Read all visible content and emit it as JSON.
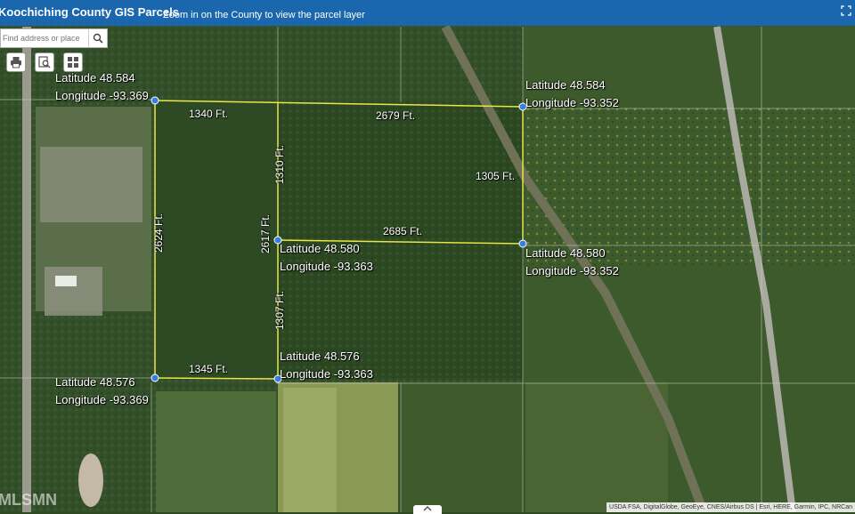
{
  "header": {
    "title": "Koochiching County GIS Parcels",
    "message": "Zoom in on the County to view the parcel layer"
  },
  "search": {
    "placeholder": "Find address or place"
  },
  "toolbar": {
    "print_icon": "printer-icon",
    "find_icon": "search-list-icon",
    "apps_icon": "grid-icon"
  },
  "points": {
    "nw": {
      "lat": "Latitude 48.584",
      "lon": "Longitude -93.369"
    },
    "ne": {
      "lat": "Latitude 48.584",
      "lon": "Longitude -93.352"
    },
    "mid": {
      "lat": "Latitude 48.580",
      "lon": "Longitude -93.363"
    },
    "e": {
      "lat": "Latitude 48.580",
      "lon": "Longitude -93.352"
    },
    "sm": {
      "lat": "Latitude 48.576",
      "lon": "Longitude -93.363"
    },
    "sw": {
      "lat": "Latitude 48.576",
      "lon": "Longitude -93.369"
    }
  },
  "distances": {
    "top_left": "1340 Ft.",
    "top_right": "2679 Ft.",
    "right": "1305 Ft.",
    "mid_h": "2685 Ft.",
    "mid_v_top": "1310 Ft.",
    "mid_v_mid": "2617 Ft.",
    "mid_v_bottom": "1307 Ft.",
    "left": "2624 Ft.",
    "bottom": "1345 Ft."
  },
  "attribution": "USDA FSA, DigitalGlobe, GeoEye, CNES/Airbus DS | Esri, HERE, Garmin, IPC, NRCan",
  "watermark": "MLSMN",
  "colors": {
    "header": "#1a67ad",
    "survey_line": "#e8e64a",
    "point": "#3a7de0"
  }
}
